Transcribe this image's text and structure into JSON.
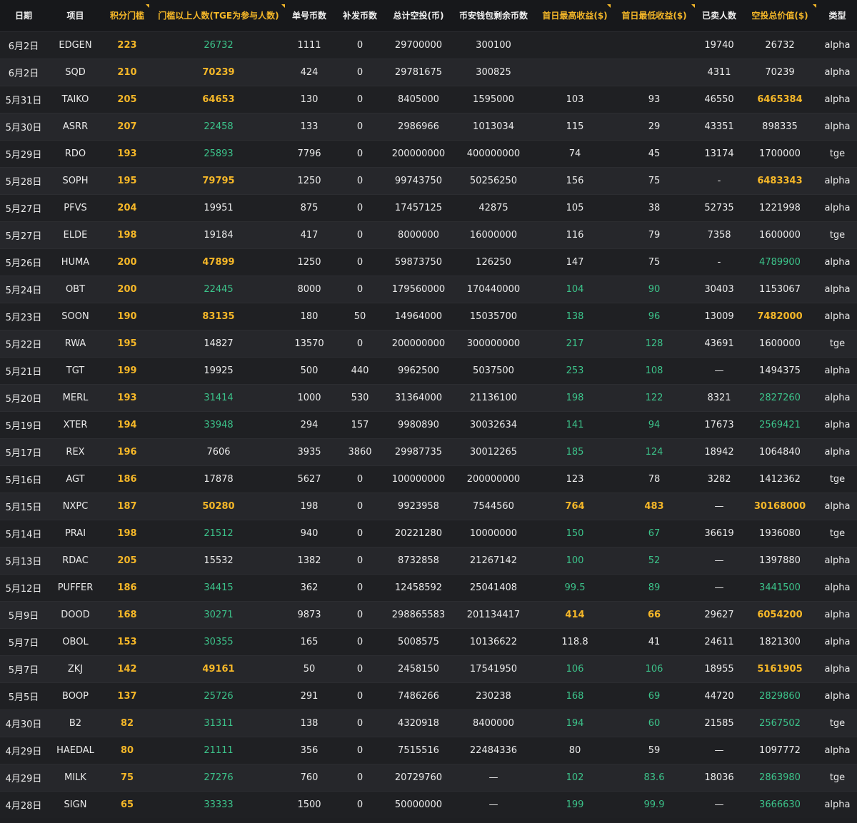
{
  "headers": [
    "日期",
    "项目",
    "积分门槛",
    "门槛以上人数(TGE为参与人数)",
    "单号币数",
    "补发币数",
    "总计空投(币)",
    "币安钱包剩余币数",
    "首日最高收益($)",
    "首日最低收益($)",
    "已卖人数",
    "空投总价值($)",
    "类型"
  ],
  "colors": {
    "gold": "#f5b728",
    "green": "#3cc38a",
    "white": "#eaeaea"
  },
  "rows": [
    {
      "c": [
        "6月2日",
        "EDGEN",
        "223",
        "26732",
        "1111",
        "0",
        "29700000",
        "300100",
        "",
        "",
        "19740",
        "26732",
        "alpha"
      ],
      "s": {
        "3": "g"
      }
    },
    {
      "c": [
        "6月2日",
        "SQD",
        "210",
        "70239",
        "424",
        "0",
        "29781675",
        "300825",
        "",
        "",
        "4311",
        "70239",
        "alpha"
      ],
      "s": {
        "3": "y"
      }
    },
    {
      "c": [
        "5月31日",
        "TAIKO",
        "205",
        "64653",
        "130",
        "0",
        "8405000",
        "1595000",
        "103",
        "93",
        "46550",
        "6465384",
        "alpha"
      ],
      "s": {
        "3": "y",
        "11": "y"
      }
    },
    {
      "c": [
        "5月30日",
        "ASRR",
        "207",
        "22458",
        "133",
        "0",
        "2986966",
        "1013034",
        "115",
        "29",
        "43351",
        "898335",
        "alpha"
      ],
      "s": {
        "3": "g"
      }
    },
    {
      "c": [
        "5月29日",
        "RDO",
        "193",
        "25893",
        "7796",
        "0",
        "200000000",
        "400000000",
        "74",
        "45",
        "13174",
        "1700000",
        "tge"
      ],
      "s": {
        "3": "g"
      }
    },
    {
      "c": [
        "5月28日",
        "SOPH",
        "195",
        "79795",
        "1250",
        "0",
        "99743750",
        "50256250",
        "156",
        "75",
        "-",
        "6483343",
        "alpha"
      ],
      "s": {
        "3": "y",
        "11": "y"
      }
    },
    {
      "c": [
        "5月27日",
        "PFVS",
        "204",
        "19951",
        "875",
        "0",
        "17457125",
        "42875",
        "105",
        "38",
        "52735",
        "1221998",
        "alpha"
      ],
      "s": {}
    },
    {
      "c": [
        "5月27日",
        "ELDE",
        "198",
        "19184",
        "417",
        "0",
        "8000000",
        "16000000",
        "116",
        "79",
        "7358",
        "1600000",
        "tge"
      ],
      "s": {}
    },
    {
      "c": [
        "5月26日",
        "HUMA",
        "200",
        "47899",
        "1250",
        "0",
        "59873750",
        "126250",
        "147",
        "75",
        "-",
        "4789900",
        "alpha"
      ],
      "s": {
        "3": "y",
        "11": "g"
      }
    },
    {
      "c": [
        "5月24日",
        "OBT",
        "200",
        "22445",
        "8000",
        "0",
        "179560000",
        "170440000",
        "104",
        "90",
        "30403",
        "1153067",
        "alpha"
      ],
      "s": {
        "3": "g",
        "8": "g",
        "9": "g"
      }
    },
    {
      "c": [
        "5月23日",
        "SOON",
        "190",
        "83135",
        "180",
        "50",
        "14964000",
        "15035700",
        "138",
        "96",
        "13009",
        "7482000",
        "alpha"
      ],
      "s": {
        "3": "y",
        "8": "g",
        "9": "g",
        "11": "y"
      }
    },
    {
      "c": [
        "5月22日",
        "RWA",
        "195",
        "14827",
        "13570",
        "0",
        "200000000",
        "300000000",
        "217",
        "128",
        "43691",
        "1600000",
        "tge"
      ],
      "s": {
        "8": "g",
        "9": "g"
      }
    },
    {
      "c": [
        "5月21日",
        "TGT",
        "199",
        "19925",
        "500",
        "440",
        "9962500",
        "5037500",
        "253",
        "108",
        "—",
        "1494375",
        "alpha"
      ],
      "s": {
        "8": "g",
        "9": "g"
      }
    },
    {
      "c": [
        "5月20日",
        "MERL",
        "193",
        "31414",
        "1000",
        "530",
        "31364000",
        "21136100",
        "198",
        "122",
        "8321",
        "2827260",
        "alpha"
      ],
      "s": {
        "3": "g",
        "8": "g",
        "9": "g",
        "11": "g"
      }
    },
    {
      "c": [
        "5月19日",
        "XTER",
        "194",
        "33948",
        "294",
        "157",
        "9980890",
        "30032634",
        "141",
        "94",
        "17673",
        "2569421",
        "alpha"
      ],
      "s": {
        "3": "g",
        "8": "g",
        "9": "g",
        "11": "g"
      }
    },
    {
      "c": [
        "5月17日",
        "REX",
        "196",
        "7606",
        "3935",
        "3860",
        "29987735",
        "30012265",
        "185",
        "124",
        "18942",
        "1064840",
        "alpha"
      ],
      "s": {
        "8": "g",
        "9": "g"
      }
    },
    {
      "c": [
        "5月16日",
        "AGT",
        "186",
        "17878",
        "5627",
        "0",
        "100000000",
        "200000000",
        "123",
        "78",
        "3282",
        "1412362",
        "tge"
      ],
      "s": {}
    },
    {
      "c": [
        "5月15日",
        "NXPC",
        "187",
        "50280",
        "198",
        "0",
        "9923958",
        "7544560",
        "764",
        "483",
        "—",
        "30168000",
        "alpha"
      ],
      "s": {
        "3": "y",
        "8": "y",
        "9": "y",
        "11": "y"
      }
    },
    {
      "c": [
        "5月14日",
        "PRAI",
        "198",
        "21512",
        "940",
        "0",
        "20221280",
        "10000000",
        "150",
        "67",
        "36619",
        "1936080",
        "tge"
      ],
      "s": {
        "3": "g",
        "8": "g",
        "9": "g"
      }
    },
    {
      "c": [
        "5月13日",
        "RDAC",
        "205",
        "15532",
        "1382",
        "0",
        "8732858",
        "21267142",
        "100",
        "52",
        "—",
        "1397880",
        "alpha"
      ],
      "s": {
        "8": "g",
        "9": "g"
      }
    },
    {
      "c": [
        "5月12日",
        "PUFFER",
        "186",
        "34415",
        "362",
        "0",
        "12458592",
        "25041408",
        "99.5",
        "89",
        "—",
        "3441500",
        "alpha"
      ],
      "s": {
        "3": "g",
        "8": "g",
        "9": "g",
        "11": "g"
      }
    },
    {
      "c": [
        "5月9日",
        "DOOD",
        "168",
        "30271",
        "9873",
        "0",
        "298865583",
        "201134417",
        "414",
        "66",
        "29627",
        "6054200",
        "alpha"
      ],
      "s": {
        "3": "g",
        "8": "y",
        "9": "y",
        "11": "y"
      }
    },
    {
      "c": [
        "5月7日",
        "OBOL",
        "153",
        "30355",
        "165",
        "0",
        "5008575",
        "10136622",
        "118.8",
        "41",
        "24611",
        "1821300",
        "alpha"
      ],
      "s": {
        "3": "g"
      }
    },
    {
      "c": [
        "5月7日",
        "ZKJ",
        "142",
        "49161",
        "50",
        "0",
        "2458150",
        "17541950",
        "106",
        "106",
        "18955",
        "5161905",
        "alpha"
      ],
      "s": {
        "3": "y",
        "8": "g",
        "9": "g",
        "11": "y"
      }
    },
    {
      "c": [
        "5月5日",
        "BOOP",
        "137",
        "25726",
        "291",
        "0",
        "7486266",
        "230238",
        "168",
        "69",
        "44720",
        "2829860",
        "alpha"
      ],
      "s": {
        "3": "g",
        "8": "g",
        "9": "g",
        "11": "g"
      }
    },
    {
      "c": [
        "4月30日",
        "B2",
        "82",
        "31311",
        "138",
        "0",
        "4320918",
        "8400000",
        "194",
        "60",
        "21585",
        "2567502",
        "tge"
      ],
      "s": {
        "3": "g",
        "8": "g",
        "9": "g",
        "11": "g"
      }
    },
    {
      "c": [
        "4月29日",
        "HAEDAL",
        "80",
        "21111",
        "356",
        "0",
        "7515516",
        "22484336",
        "80",
        "59",
        "—",
        "1097772",
        "alpha"
      ],
      "s": {
        "3": "g"
      }
    },
    {
      "c": [
        "4月29日",
        "MILK",
        "75",
        "27276",
        "760",
        "0",
        "20729760",
        "—",
        "102",
        "83.6",
        "18036",
        "2863980",
        "tge"
      ],
      "s": {
        "3": "g",
        "8": "g",
        "9": "g",
        "11": "g"
      }
    },
    {
      "c": [
        "4月28日",
        "SIGN",
        "65",
        "33333",
        "1500",
        "0",
        "50000000",
        "—",
        "199",
        "99.9",
        "—",
        "3666630",
        "alpha"
      ],
      "s": {
        "3": "g",
        "8": "g",
        "9": "g",
        "11": "g"
      }
    }
  ]
}
